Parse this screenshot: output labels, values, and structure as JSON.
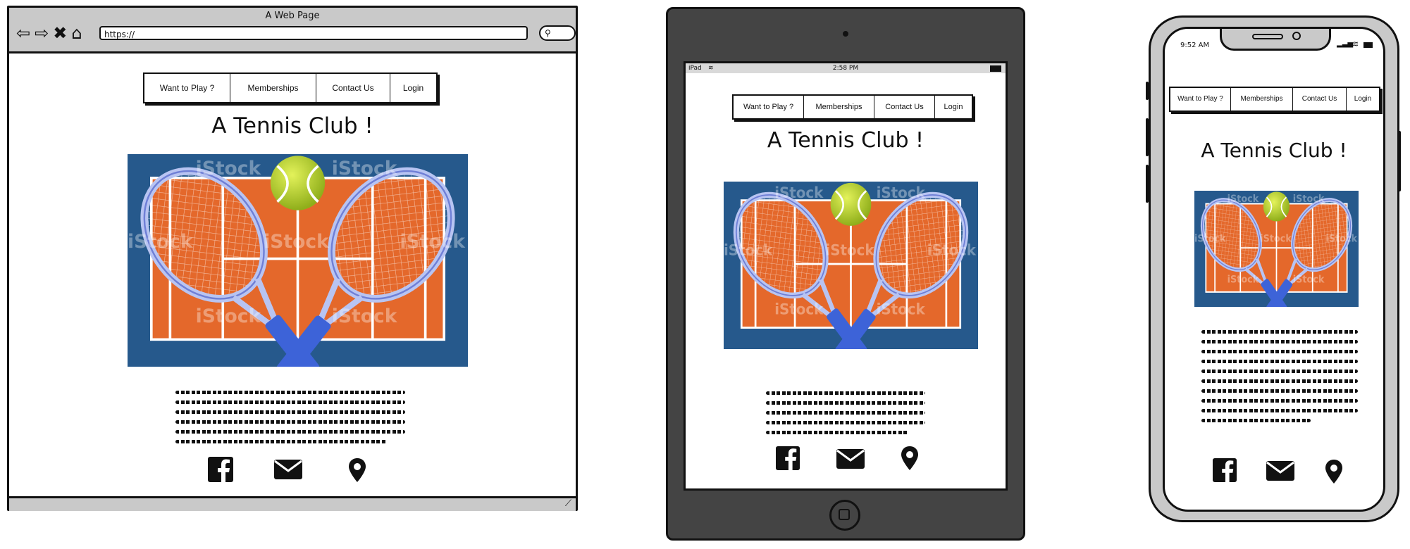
{
  "browser": {
    "title": "A Web Page",
    "url": "https://",
    "nav": [
      "Want to Play ?",
      "Memberships",
      "Contact Us",
      "Login"
    ],
    "heading": "A Tennis Club !"
  },
  "tablet": {
    "status_left": "iPad",
    "status_time": "2:58 PM",
    "nav": [
      "Want to Play ?",
      "Memberships",
      "Contact Us",
      "Login"
    ],
    "heading": "A Tennis Club !"
  },
  "phone": {
    "status_time": "9:52 AM",
    "nav": [
      "Want to Play ?",
      "Memberships",
      "Contact Us",
      "Login"
    ],
    "heading": "A Tennis Club !"
  },
  "image_watermark": "iStock",
  "icons": [
    "facebook-icon",
    "envelope-icon",
    "map-pin-icon"
  ],
  "colors": {
    "court_orange": "#e4682b",
    "court_blue": "#26598c",
    "racket_blue": "#3d63d8",
    "ball_yellow": "#b9d62e",
    "chrome_gray": "#c9c9c9",
    "tablet_body": "#444444"
  }
}
